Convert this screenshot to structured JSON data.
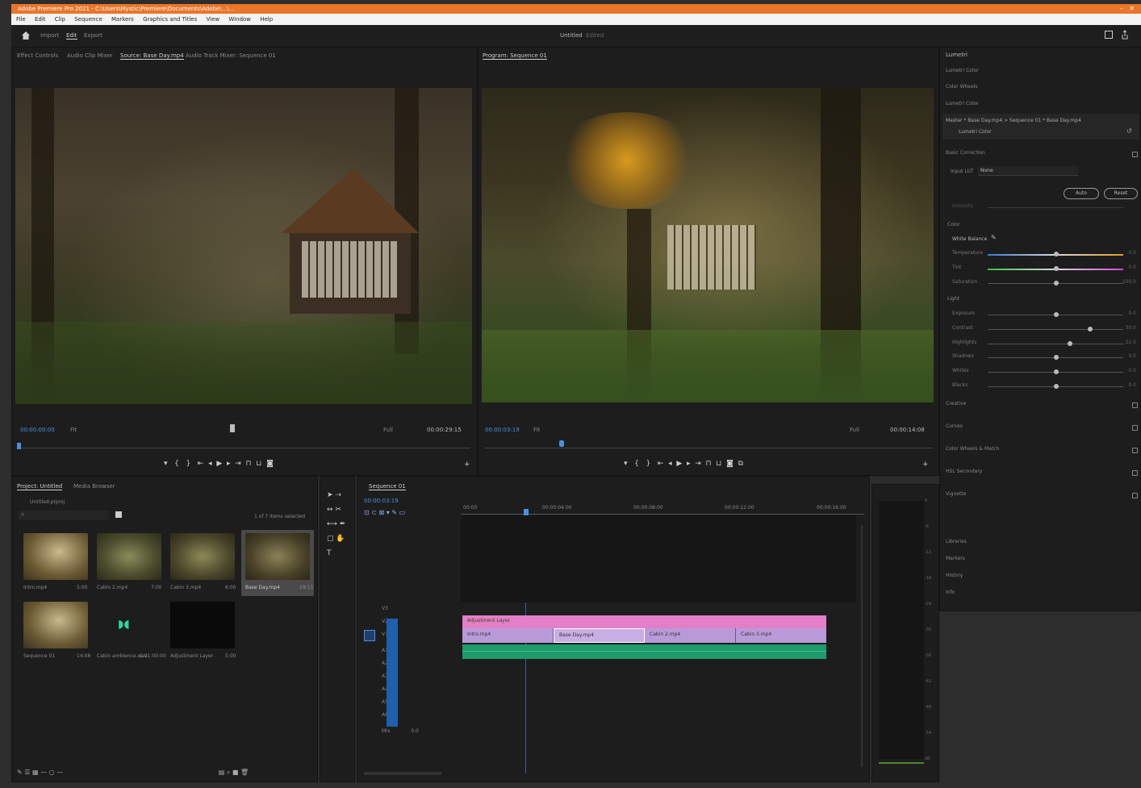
{
  "window": {
    "title": "Adobe Premiere Pro 2021 - C:\\Users\\Mystic\\Premiere\\Documents\\Adobe\\...\\..."
  },
  "menubar": {
    "items": [
      "File",
      "Edit",
      "Clip",
      "Sequence",
      "Markers",
      "Graphics and Titles",
      "View",
      "Window",
      "Help"
    ]
  },
  "workspace": {
    "tabs": [
      "Import",
      "Edit",
      "Export"
    ],
    "active_tab": "Edit",
    "project_label": "Untitled",
    "project_sub": "Edited"
  },
  "source_monitor": {
    "tabs": [
      "Effect Controls",
      "Audio Clip Mixer",
      "Source: Base Day.mp4",
      "Audio Track Mixer: Sequence 01"
    ],
    "active_tab_index": 2,
    "timecode_in": "00:00:00:00",
    "fit": "Fit",
    "resolution": "Full",
    "timecode_dur": "00:00:29:15"
  },
  "program_monitor": {
    "title": "Program: Sequence 01",
    "timecode": "00:00:03:19",
    "fit": "Fit",
    "resolution": "Full",
    "timecode_dur": "00:00:14:08"
  },
  "lumetri": {
    "title": "Lumetri",
    "rows": [
      "Lumetri Color",
      "Color Wheels",
      "Lumetri Color"
    ],
    "clip_path": "Master * Base Day.mp4  >  Sequence 01 * Base Day.mp4",
    "fx": "Lumetri Color",
    "section_basic": "Basic Correction",
    "input_lut_label": "Input LUT",
    "input_lut_value": "None",
    "auto_label": "Auto",
    "reset_label": "Reset",
    "intensity_label": "Intensity",
    "color_header": "Color",
    "wb_label": "White Balance",
    "color_sliders": [
      {
        "label": "Temperature",
        "value": "0.0",
        "pos": 0.5
      },
      {
        "label": "Tint",
        "value": "0.0",
        "pos": 0.5
      },
      {
        "label": "Saturation",
        "value": "100.0",
        "pos": 0.5
      }
    ],
    "light_header": "Light",
    "light_sliders": [
      {
        "label": "Exposure",
        "value": "0.0",
        "pos": 0.5
      },
      {
        "label": "Contrast",
        "value": "30.0",
        "pos": 0.75
      },
      {
        "label": "Highlights",
        "value": "22.0",
        "pos": 0.6
      },
      {
        "label": "Shadows",
        "value": "0.0",
        "pos": 0.5
      },
      {
        "label": "Whites",
        "value": "0.0",
        "pos": 0.5
      },
      {
        "label": "Blacks",
        "value": "0.0",
        "pos": 0.5
      }
    ],
    "sections": [
      "Creative",
      "Curves",
      "Color Wheels & Match",
      "HSL Secondary",
      "Vignette"
    ],
    "lower_items": [
      "Libraries",
      "Markers",
      "History",
      "Info"
    ]
  },
  "project_panel": {
    "tabs": [
      "Project: Untitled",
      "Media Browser"
    ],
    "bin": "Untitled.prproj",
    "search_placeholder": "",
    "items_count": "1 of 7 items selected",
    "items": [
      {
        "name": "Intro.mp4",
        "dur": "5:00"
      },
      {
        "name": "Cabin 2.mp4",
        "dur": "7:00"
      },
      {
        "name": "Cabin 3.mp4",
        "dur": "6:00"
      },
      {
        "name": "Base Day.mp4",
        "dur": "29:15"
      },
      {
        "name": "Sequence 01",
        "dur": "14:08"
      },
      {
        "name": "Cabin ambience.wav",
        "dur": "1:01:00:00"
      },
      {
        "name": "Adjustment Layer",
        "dur": "5:00"
      }
    ]
  },
  "timeline": {
    "tab": "Sequence 01",
    "timecode": "00:00:03:19",
    "ruler": [
      "00:00",
      "00:00:04:00",
      "00:00:08:00",
      "00:00:12:00",
      "00:00:16:00"
    ],
    "video_tracks": [
      "V3",
      "V2",
      "V1"
    ],
    "audio_tracks": [
      "A1",
      "A2",
      "A3",
      "A4",
      "A5",
      "A6"
    ],
    "mix_label": "Mix",
    "mix_value": "0.0",
    "adjustment_clip": "Adjustment Layer",
    "clips_v1": [
      "Intro.mp4",
      "Base Day.mp4",
      "Cabin 2.mp4",
      "Cabin 3.mp4"
    ],
    "meter_ticks": [
      "0",
      "-6",
      "-12",
      "-18",
      "-24",
      "-30",
      "-36",
      "-42",
      "-48",
      "-54",
      "dB"
    ]
  },
  "colors": {
    "accent_orange": "#e8762b",
    "timecode_blue": "#4a8fe2",
    "adjustment_pink": "#e27fc8",
    "clip_violet": "#b99ad8",
    "audio_green": "#1d9b6b",
    "panel_bg": "#1d1d1d"
  }
}
